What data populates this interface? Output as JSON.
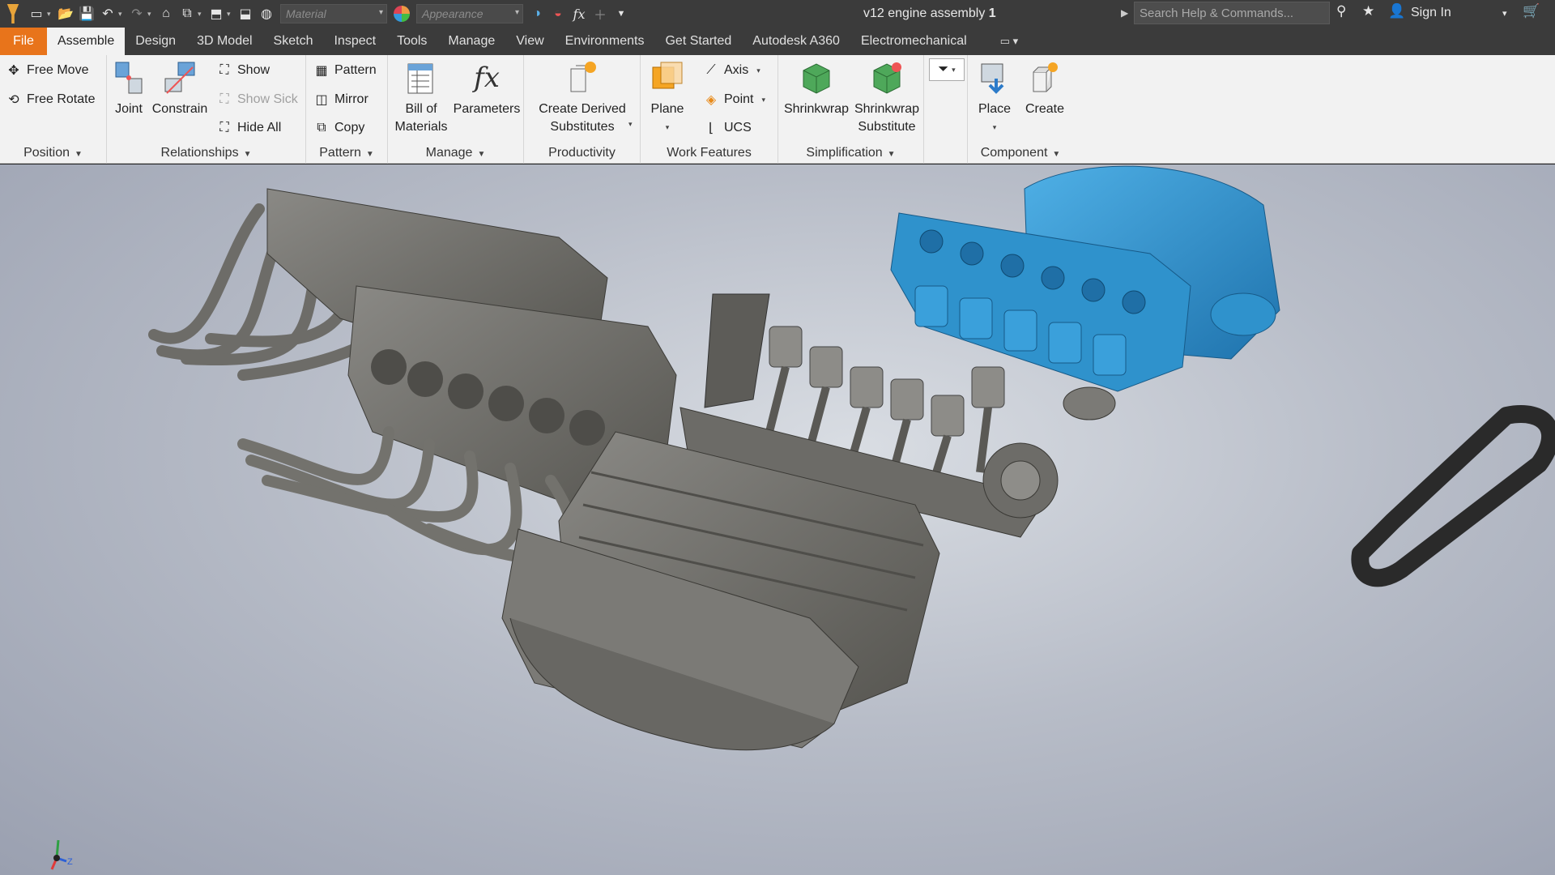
{
  "quick_access": {
    "material_placeholder": "Material",
    "appearance_placeholder": "Appearance",
    "function_glyph": "fx"
  },
  "document": {
    "title_prefix": "v12 engine assembly",
    "title_number": "1"
  },
  "search": {
    "placeholder": "Search Help & Commands..."
  },
  "account": {
    "sign_in": "Sign In"
  },
  "tabs": [
    {
      "label": "File"
    },
    {
      "label": "Assemble"
    },
    {
      "label": "Design"
    },
    {
      "label": "3D Model"
    },
    {
      "label": "Sketch"
    },
    {
      "label": "Inspect"
    },
    {
      "label": "Tools"
    },
    {
      "label": "Manage"
    },
    {
      "label": "View"
    },
    {
      "label": "Environments"
    },
    {
      "label": "Get Started"
    },
    {
      "label": "Autodesk A360"
    },
    {
      "label": "Electromechanical"
    }
  ],
  "ribbon": {
    "position": {
      "title": "Position",
      "free_move": "Free Move",
      "free_rotate": "Free Rotate"
    },
    "relationships": {
      "title": "Relationships",
      "joint": "Joint",
      "constrain": "Constrain",
      "show": "Show",
      "show_sick": "Show Sick",
      "hide_all": "Hide All"
    },
    "pattern": {
      "title": "Pattern",
      "pattern": "Pattern",
      "mirror": "Mirror",
      "copy": "Copy"
    },
    "manage": {
      "title": "Manage",
      "bom_line1": "Bill of",
      "bom_line2": "Materials",
      "parameters": "Parameters",
      "parameters_glyph": "fx"
    },
    "productivity": {
      "title": "Productivity",
      "derived_line1": "Create Derived",
      "derived_line2": "Substitutes"
    },
    "work_features": {
      "title": "Work Features",
      "plane": "Plane",
      "axis": "Axis",
      "point": "Point",
      "ucs": "UCS"
    },
    "simplification": {
      "title": "Simplification",
      "shrinkwrap": "Shrinkwrap",
      "shrinkwrap_sub_line1": "Shrinkwrap",
      "shrinkwrap_sub_line2": "Substitute"
    },
    "component": {
      "title": "Component",
      "place": "Place",
      "create": "Create"
    }
  },
  "viewport": {
    "triad_z": "Z"
  },
  "colors": {
    "file_tab": "#e8741b",
    "selection_blue": "#2e8fc9",
    "part_gray": "#6b6a66"
  }
}
